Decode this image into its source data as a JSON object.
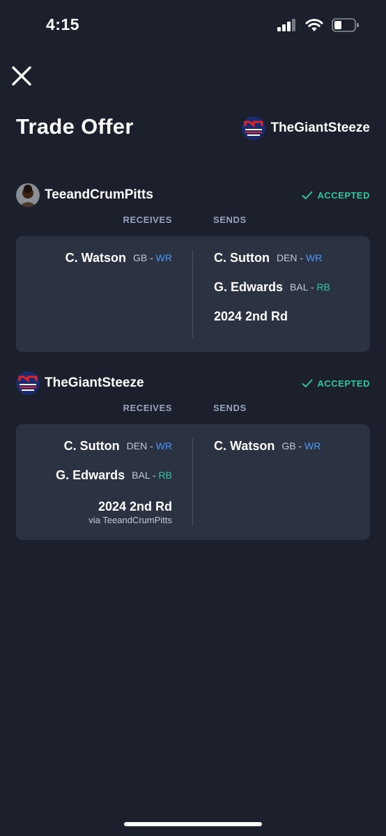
{
  "status_bar": {
    "time": "4:15",
    "icons": [
      "cellular-signal-icon",
      "wifi-icon",
      "battery-icon"
    ]
  },
  "header": {
    "close_icon": "close-icon",
    "title": "Trade Offer",
    "user": "TheGiantSteeze"
  },
  "colors": {
    "background": "#1b202c",
    "card": "#2b3242",
    "accepted": "#2fc5a1",
    "wr": "#4f97f7",
    "rb": "#2fc5a1"
  },
  "sections": [
    {
      "user": "TeeandCrumPitts",
      "status": "ACCEPTED",
      "receives_label": "RECEIVES",
      "sends_label": "SENDS",
      "receives": [
        {
          "name": "C. Watson",
          "team": "GB",
          "sep": " - ",
          "pos": "WR"
        }
      ],
      "sends": [
        {
          "name": "C. Sutton",
          "team": "DEN",
          "sep": " - ",
          "pos": "WR"
        },
        {
          "name": "G. Edwards",
          "team": "BAL",
          "sep": " - ",
          "pos": "RB"
        },
        {
          "name": "2024 2nd Rd"
        }
      ]
    },
    {
      "user": "TheGiantSteeze",
      "status": "ACCEPTED",
      "receives_label": "RECEIVES",
      "sends_label": "SENDS",
      "receives": [
        {
          "name": "C. Sutton",
          "team": "DEN",
          "sep": " - ",
          "pos": "WR"
        },
        {
          "name": "G. Edwards",
          "team": "BAL",
          "sep": " - ",
          "pos": "RB"
        },
        {
          "name": "2024 2nd Rd",
          "via": "via TeeandCrumPitts"
        }
      ],
      "sends": [
        {
          "name": "C. Watson",
          "team": "GB",
          "sep": " - ",
          "pos": "WR"
        }
      ]
    }
  ]
}
